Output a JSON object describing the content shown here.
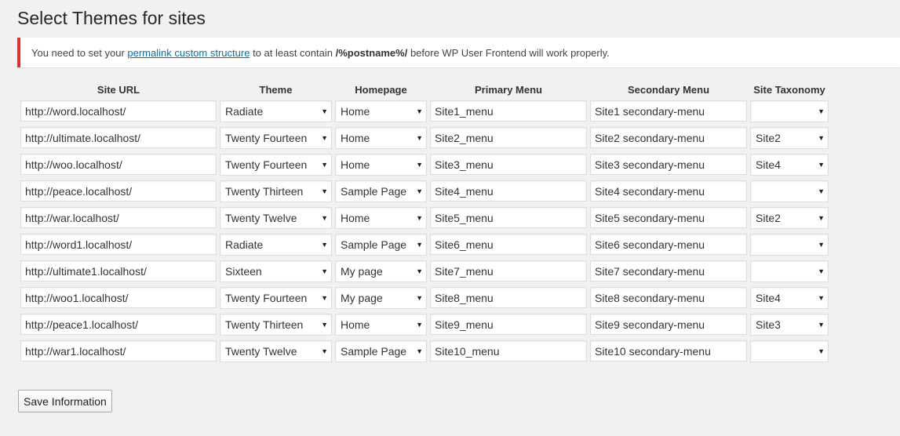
{
  "page": {
    "title": "Select Themes for sites"
  },
  "notice": {
    "before_link": "You need to set your ",
    "link_text": "permalink custom structure",
    "middle": " to at least contain ",
    "code": "/%postname%/",
    "after": " before WP User Frontend will work properly.",
    "accent_color": "#dc3232"
  },
  "table": {
    "headers": [
      "Site URL",
      "Theme",
      "Homepage",
      "Primary Menu",
      "Secondary Menu",
      "Site Taxonomy"
    ],
    "rows": [
      {
        "url": "http://word.localhost/",
        "theme": "Radiate",
        "homepage": "Home",
        "primary": "Site1_menu",
        "secondary": "Site1 secondary-menu",
        "taxonomy": ""
      },
      {
        "url": "http://ultimate.localhost/",
        "theme": "Twenty Fourteen",
        "homepage": "Home",
        "primary": "Site2_menu",
        "secondary": "Site2 secondary-menu",
        "taxonomy": "Site2"
      },
      {
        "url": "http://woo.localhost/",
        "theme": "Twenty Fourteen",
        "homepage": "Home",
        "primary": "Site3_menu",
        "secondary": "Site3 secondary-menu",
        "taxonomy": "Site4"
      },
      {
        "url": "http://peace.localhost/",
        "theme": "Twenty Thirteen",
        "homepage": "Sample Page",
        "primary": "Site4_menu",
        "secondary": "Site4 secondary-menu",
        "taxonomy": ""
      },
      {
        "url": "http://war.localhost/",
        "theme": "Twenty Twelve",
        "homepage": "Home",
        "primary": "Site5_menu",
        "secondary": "Site5 secondary-menu",
        "taxonomy": "Site2"
      },
      {
        "url": "http://word1.localhost/",
        "theme": "Radiate",
        "homepage": "Sample Page",
        "primary": "Site6_menu",
        "secondary": "Site6 secondary-menu",
        "taxonomy": ""
      },
      {
        "url": "http://ultimate1.localhost/",
        "theme": "Sixteen",
        "homepage": "My page",
        "primary": "Site7_menu",
        "secondary": "Site7 secondary-menu",
        "taxonomy": ""
      },
      {
        "url": "http://woo1.localhost/",
        "theme": "Twenty Fourteen",
        "homepage": "My page",
        "primary": "Site8_menu",
        "secondary": "Site8 secondary-menu",
        "taxonomy": "Site4"
      },
      {
        "url": "http://peace1.localhost/",
        "theme": "Twenty Thirteen",
        "homepage": "Home",
        "primary": "Site9_menu",
        "secondary": "Site9 secondary-menu",
        "taxonomy": "Site3"
      },
      {
        "url": "http://war1.localhost/",
        "theme": "Twenty Twelve",
        "homepage": "Sample Page",
        "primary": "Site10_menu",
        "secondary": "Site10 secondary-menu",
        "taxonomy": ""
      }
    ]
  },
  "icons": {
    "dropdown": "chevron-down-icon"
  },
  "actions": {
    "save_label": "Save Information"
  }
}
